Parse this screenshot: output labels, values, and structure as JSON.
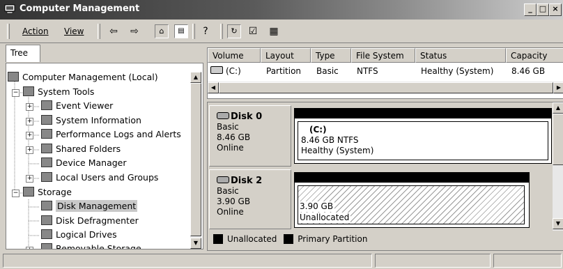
{
  "window": {
    "title": "Computer Management",
    "minimize_label": "_",
    "maximize_label": "□",
    "close_label": "×"
  },
  "menubar": {
    "action_label": "Action",
    "view_label": "View"
  },
  "toolbar_icons": [
    "back-arrow-icon",
    "forward-arrow-icon",
    "up-folder-icon",
    "show-hide-tree-icon",
    "help-icon",
    "refresh-icon",
    "properties-icon",
    "disk-icon"
  ],
  "tree": {
    "tab_label": "Tree",
    "items": [
      {
        "label": "Computer Management (Local)",
        "icon": "computer-icon"
      },
      {
        "label": "System Tools",
        "icon": "tools-icon"
      },
      {
        "label": "Event Viewer",
        "icon": "event-viewer-icon"
      },
      {
        "label": "System Information",
        "icon": "system-info-icon"
      },
      {
        "label": "Performance Logs and Alerts",
        "icon": "performance-icon"
      },
      {
        "label": "Shared Folders",
        "icon": "shared-folders-icon"
      },
      {
        "label": "Device Manager",
        "icon": "device-manager-icon"
      },
      {
        "label": "Local Users and Groups",
        "icon": "users-icon"
      },
      {
        "label": "Storage",
        "icon": "storage-icon"
      },
      {
        "label": "Disk Management",
        "icon": "disk-management-icon"
      },
      {
        "label": "Disk Defragmenter",
        "icon": "defrag-icon"
      },
      {
        "label": "Logical Drives",
        "icon": "logical-drives-icon"
      },
      {
        "label": "Removable Storage",
        "icon": "removable-storage-icon"
      }
    ]
  },
  "volume_list": {
    "columns": [
      "Volume",
      "Layout",
      "Type",
      "File System",
      "Status",
      "Capacity"
    ],
    "rows": [
      {
        "volume": "(C:)",
        "layout": "Partition",
        "type": "Basic",
        "file_system": "NTFS",
        "status": "Healthy (System)",
        "capacity": "8.46 GB"
      }
    ]
  },
  "disks": [
    {
      "name": "Disk 0",
      "type": "Basic",
      "size": "8.46 GB",
      "state": "Online",
      "partition": {
        "label": "(C:)",
        "detail": "8.46 GB NTFS",
        "status": "Healthy (System)"
      }
    },
    {
      "name": "Disk 2",
      "type": "Basic",
      "size": "3.90 GB",
      "state": "Online",
      "partition": {
        "label": "",
        "detail": "3.90 GB",
        "status": "Unallocated"
      }
    }
  ],
  "legend": {
    "unallocated_label": "Unallocated",
    "primary_label": "Primary Partition"
  },
  "colors": {
    "title_gradient_start": "#333333",
    "window_face": "#d4d0c8",
    "selection": "#c0c0c0"
  }
}
